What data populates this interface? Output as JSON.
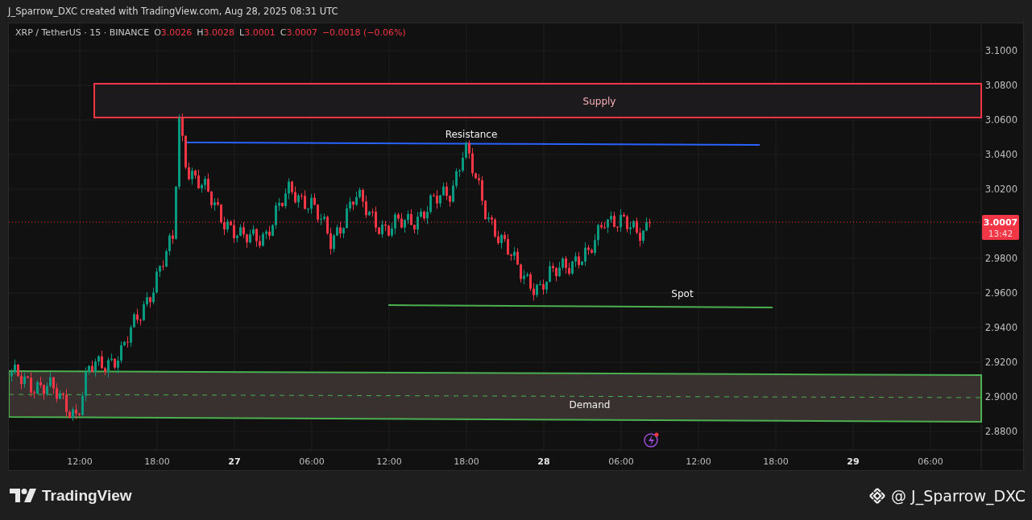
{
  "header": {
    "caption": "J_Sparrow_DXC created with TradingView.com, Aug 28, 2025 08:31 UTC"
  },
  "legend": {
    "symbol": "XRP / TetherUS · 15 · BINANCE",
    "ohlc": [
      {
        "label": "O",
        "value": "3.0026"
      },
      {
        "label": "H",
        "value": "3.0028"
      },
      {
        "label": "L",
        "value": "3.0001"
      },
      {
        "label": "C",
        "value": "3.0007"
      }
    ],
    "change": "−0.0018 (−0.06%)"
  },
  "price_axis": [
    "3.1000",
    "3.0800",
    "3.0600",
    "3.0400",
    "3.0200",
    "2.9800",
    "2.9600",
    "2.9400",
    "2.9200",
    "2.9000",
    "2.8800"
  ],
  "price_badge": {
    "price": "3.0007",
    "countdown": "13:42"
  },
  "time_axis": [
    {
      "label": "12:00",
      "kind": "time"
    },
    {
      "label": "18:00",
      "kind": "time"
    },
    {
      "label": "27",
      "kind": "day"
    },
    {
      "label": "06:00",
      "kind": "time"
    },
    {
      "label": "12:00",
      "kind": "time"
    },
    {
      "label": "18:00",
      "kind": "time"
    },
    {
      "label": "28",
      "kind": "day"
    },
    {
      "label": "06:00",
      "kind": "time"
    },
    {
      "label": "12:00",
      "kind": "time"
    },
    {
      "label": "18:00",
      "kind": "time"
    },
    {
      "label": "29",
      "kind": "day"
    },
    {
      "label": "06:00",
      "kind": "time"
    }
  ],
  "zones": [
    {
      "kind": "supply",
      "label": "Supply"
    },
    {
      "kind": "resistance",
      "label": "Resistance"
    },
    {
      "kind": "spot",
      "label": "Spot"
    },
    {
      "kind": "demand",
      "label": "Demand"
    }
  ],
  "footer": {
    "brand": "TradingView",
    "author": "@ J_Sparrow_DXC"
  }
}
